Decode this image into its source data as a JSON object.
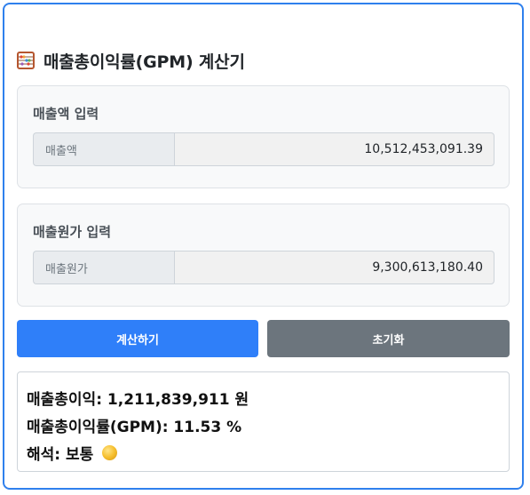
{
  "header": {
    "icon": "abacus-icon",
    "title": "매출총이익률(GPM) 계산기"
  },
  "revenue_section": {
    "label": "매출액 입력",
    "prefix": "매출액",
    "value": "10,512,453,091.39"
  },
  "cost_section": {
    "label": "매출원가 입력",
    "prefix": "매출원가",
    "value": "9,300,613,180.40"
  },
  "buttons": {
    "calculate": "계산하기",
    "reset": "초기화"
  },
  "result": {
    "gross_profit": "매출총이익: 1,211,839,911 원",
    "gpm": "매출총이익률(GPM): 11.53 %",
    "interpretation": "해석: 보통",
    "interpretation_icon": "coin-icon"
  },
  "colors": {
    "accent": "#2f7ff9",
    "border_accent": "#2f80ed",
    "secondary": "#6c757d"
  }
}
